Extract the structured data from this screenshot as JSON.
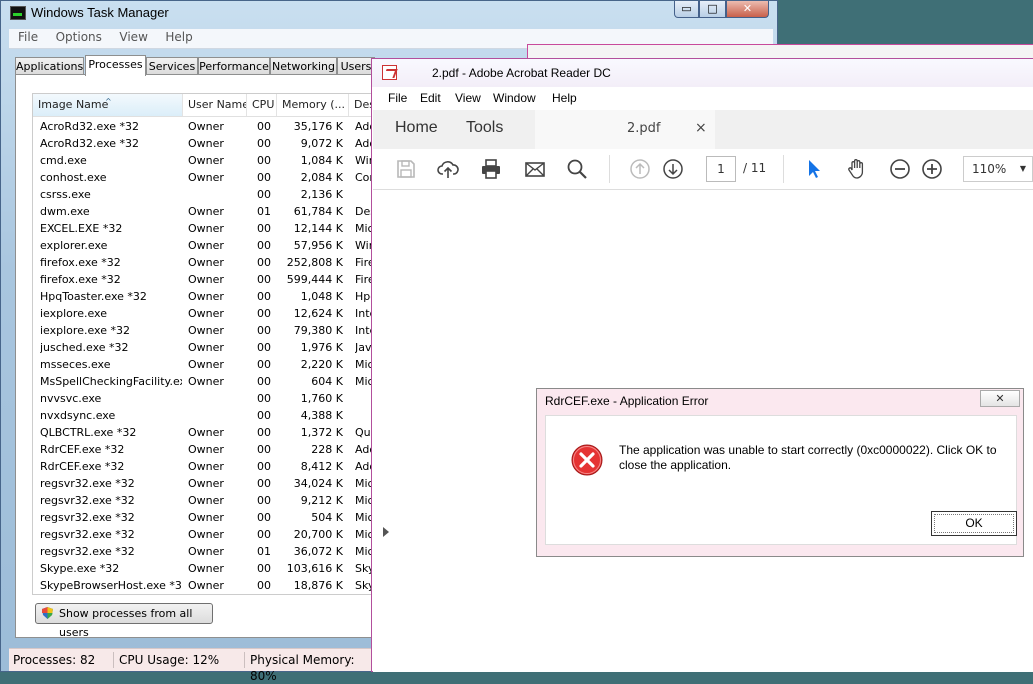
{
  "task_manager": {
    "title": "Windows Task Manager",
    "caption_buttons": {
      "minimize": "▭",
      "maximize": "□",
      "close": "✕"
    },
    "menu": [
      "File",
      "Options",
      "View",
      "Help"
    ],
    "tabs": [
      "Applications",
      "Processes",
      "Services",
      "Performance",
      "Networking",
      "Users"
    ],
    "active_tab": "Processes",
    "columns": [
      "Image Name",
      "User Name",
      "CPU",
      "Memory (...",
      "Des"
    ],
    "sort_indicator": "^",
    "processes": [
      {
        "name": "AcroRd32.exe *32",
        "user": "Owner",
        "cpu": "00",
        "mem": "35,176 K",
        "desc": "Ado"
      },
      {
        "name": "AcroRd32.exe *32",
        "user": "Owner",
        "cpu": "00",
        "mem": "9,072 K",
        "desc": "Ado"
      },
      {
        "name": "cmd.exe",
        "user": "Owner",
        "cpu": "00",
        "mem": "1,084 K",
        "desc": "Win"
      },
      {
        "name": "conhost.exe",
        "user": "Owner",
        "cpu": "00",
        "mem": "2,084 K",
        "desc": "Con"
      },
      {
        "name": "csrss.exe",
        "user": "",
        "cpu": "00",
        "mem": "2,136 K",
        "desc": ""
      },
      {
        "name": "dwm.exe",
        "user": "Owner",
        "cpu": "01",
        "mem": "61,784 K",
        "desc": "Des"
      },
      {
        "name": "EXCEL.EXE *32",
        "user": "Owner",
        "cpu": "00",
        "mem": "12,144 K",
        "desc": "Micr"
      },
      {
        "name": "explorer.exe",
        "user": "Owner",
        "cpu": "00",
        "mem": "57,956 K",
        "desc": "Win"
      },
      {
        "name": "firefox.exe *32",
        "user": "Owner",
        "cpu": "00",
        "mem": "252,808 K",
        "desc": "Fire"
      },
      {
        "name": "firefox.exe *32",
        "user": "Owner",
        "cpu": "00",
        "mem": "599,444 K",
        "desc": "Fire"
      },
      {
        "name": "HpqToaster.exe *32",
        "user": "Owner",
        "cpu": "00",
        "mem": "1,048 K",
        "desc": "Hpq"
      },
      {
        "name": "iexplore.exe",
        "user": "Owner",
        "cpu": "00",
        "mem": "12,624 K",
        "desc": "Inte"
      },
      {
        "name": "iexplore.exe *32",
        "user": "Owner",
        "cpu": "00",
        "mem": "79,380 K",
        "desc": "Inte"
      },
      {
        "name": "jusched.exe *32",
        "user": "Owner",
        "cpu": "00",
        "mem": "1,976 K",
        "desc": "Java"
      },
      {
        "name": "msseces.exe",
        "user": "Owner",
        "cpu": "00",
        "mem": "2,220 K",
        "desc": "Micr"
      },
      {
        "name": "MsSpellCheckingFacility.exe",
        "user": "Owner",
        "cpu": "00",
        "mem": "604 K",
        "desc": "Micr"
      },
      {
        "name": "nvvsvc.exe",
        "user": "",
        "cpu": "00",
        "mem": "1,760 K",
        "desc": ""
      },
      {
        "name": "nvxdsync.exe",
        "user": "",
        "cpu": "00",
        "mem": "4,388 K",
        "desc": ""
      },
      {
        "name": "QLBCTRL.exe *32",
        "user": "Owner",
        "cpu": "00",
        "mem": "1,372 K",
        "desc": "Quic"
      },
      {
        "name": "RdrCEF.exe *32",
        "user": "Owner",
        "cpu": "00",
        "mem": "228 K",
        "desc": "Ado"
      },
      {
        "name": "RdrCEF.exe *32",
        "user": "Owner",
        "cpu": "00",
        "mem": "8,412 K",
        "desc": "Ado"
      },
      {
        "name": "regsvr32.exe *32",
        "user": "Owner",
        "cpu": "00",
        "mem": "34,024 K",
        "desc": "Micr"
      },
      {
        "name": "regsvr32.exe *32",
        "user": "Owner",
        "cpu": "00",
        "mem": "9,212 K",
        "desc": "Micr"
      },
      {
        "name": "regsvr32.exe *32",
        "user": "Owner",
        "cpu": "00",
        "mem": "504 K",
        "desc": "Micr"
      },
      {
        "name": "regsvr32.exe *32",
        "user": "Owner",
        "cpu": "00",
        "mem": "20,700 K",
        "desc": "Micr"
      },
      {
        "name": "regsvr32.exe *32",
        "user": "Owner",
        "cpu": "01",
        "mem": "36,072 K",
        "desc": "Micr"
      },
      {
        "name": "Skype.exe *32",
        "user": "Owner",
        "cpu": "00",
        "mem": "103,616 K",
        "desc": "Sky"
      },
      {
        "name": "SkypeBrowserHost.exe *32",
        "user": "Owner",
        "cpu": "00",
        "mem": "18,876 K",
        "desc": "Sky"
      }
    ],
    "show_all_button": "Show processes from all users",
    "status": {
      "processes": "Processes: 82",
      "cpu": "CPU Usage: 12%",
      "memory": "Physical Memory: 80%"
    }
  },
  "acrobat": {
    "title": "2.pdf - Adobe Acrobat Reader DC",
    "menu": [
      "File",
      "Edit",
      "View",
      "Window",
      "Help"
    ],
    "nav_tabs": [
      "Home",
      "Tools"
    ],
    "doc_tab": {
      "label": "2.pdf",
      "close": "×"
    },
    "page_current": "1",
    "page_total": "/  11",
    "zoom": "110%",
    "zoom_caret": "▼",
    "toolbar_icons": [
      "save-icon",
      "upload-icon",
      "print-icon",
      "mail-icon",
      "search-icon",
      "page-up-icon",
      "page-down-icon",
      "select-cursor-icon",
      "hand-tool-icon",
      "zoom-out-icon",
      "zoom-in-icon"
    ],
    "accent_color": "#1473e6"
  },
  "error_dialog": {
    "title": "RdrCEF.exe - Application Error",
    "close": "✕",
    "message": "The application was unable to start correctly (0xc0000022). Click OK to close the application.",
    "ok_label": "OK",
    "icon": "error-icon"
  }
}
